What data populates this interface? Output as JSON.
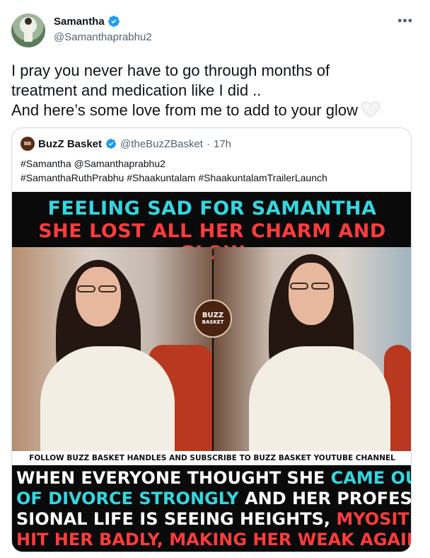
{
  "tweet": {
    "author": {
      "name": "Samantha",
      "handle": "@Samanthaprabhu2",
      "verified": true,
      "avatar_icon": "profile-photo"
    },
    "more_icon": "more-horizontal-icon",
    "text_lines": [
      "I pray you never have to go through months of",
      "treatment and medication like I did ..",
      "And here’s some love from me to add to your glow"
    ],
    "emoji": "white-heart"
  },
  "quoted": {
    "author": {
      "name": "BuzZ Basket",
      "handle": "@theBuzZBasket",
      "separator": "·",
      "time": "17h",
      "verified": true
    },
    "text_lines": [
      "#Samantha @Samanthaprabhu2",
      "#SamanthaRuthPrabhu #Shaakuntalam #ShaakuntalamTrailerLaunch"
    ],
    "media": {
      "headline_1": "FEELING SAD FOR SAMANTHA",
      "headline_2": "SHE LOST ALL HER CHARM AND GLOW",
      "logo_line_1": "BUZZ",
      "logo_line_2": "BASKET",
      "follow_text": "FOLLOW BUZZ BASKET HANDLES AND SUBSCRIBE TO BUZZ BASKET YOUTUBE CHANNEL",
      "caption": {
        "l1_white": "WHEN EVERYONE THOUGHT SHE ",
        "l1_cyan": "CAME OUT",
        "l2_cyan": "OF DIVORCE STRONGLY",
        "l2_white": " AND HER PROFES-",
        "l3_white": "SIONAL LIFE IS SEEING HEIGHTS, ",
        "l3_red": "MYOSITIS",
        "l4_red": "HIT HER BADLY, MAKING HER WEAK AGAIN"
      },
      "colors": {
        "cyan": "#34d6e0",
        "red": "#ff3b3b",
        "background": "#0a0a0a"
      }
    }
  },
  "colors": {
    "verified_blue": "#1d9bf0",
    "secondary_text": "#536471",
    "border": "#cfd9de"
  }
}
